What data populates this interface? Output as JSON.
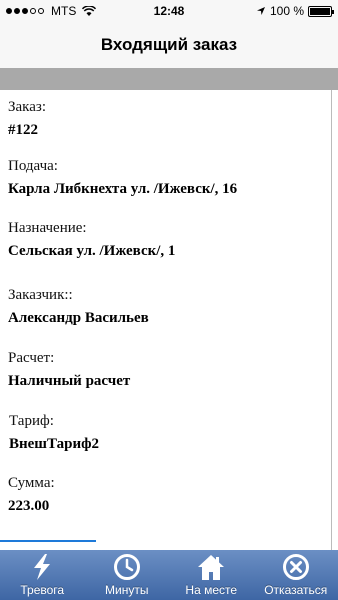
{
  "status": {
    "carrier": "MTS",
    "time": "12:48",
    "battery": "100 %"
  },
  "header": {
    "title": "Входящий заказ"
  },
  "order": {
    "number_label": "Заказ:",
    "number": "#122",
    "pickup_label": "Подача:",
    "pickup": "Карла Либкнехта ул. /Ижевск/, 16",
    "destination_label": "Назначение:",
    "destination": "Сельская ул. /Ижевск/, 1",
    "customer_label": "Заказчик::",
    "customer": "Александр Васильев",
    "payment_label": "Расчет:",
    "payment": "Наличный расчет",
    "tariff_label": "Тариф:",
    "tariff": "ВнешТариф2",
    "sum_label": "Сумма:",
    "sum": "223.00"
  },
  "tabs": [
    {
      "label": "Тревога",
      "icon": "lightning-icon"
    },
    {
      "label": "Минуты",
      "icon": "clock-icon"
    },
    {
      "label": "На месте",
      "icon": "home-icon"
    },
    {
      "label": "Отказаться",
      "icon": "cancel-icon"
    }
  ],
  "colors": {
    "tab_bar_top": "#6b8fc4",
    "tab_bar_bottom": "#3e66a4",
    "strip": "#a9a9a9",
    "accent_line": "#1e7ad9"
  }
}
